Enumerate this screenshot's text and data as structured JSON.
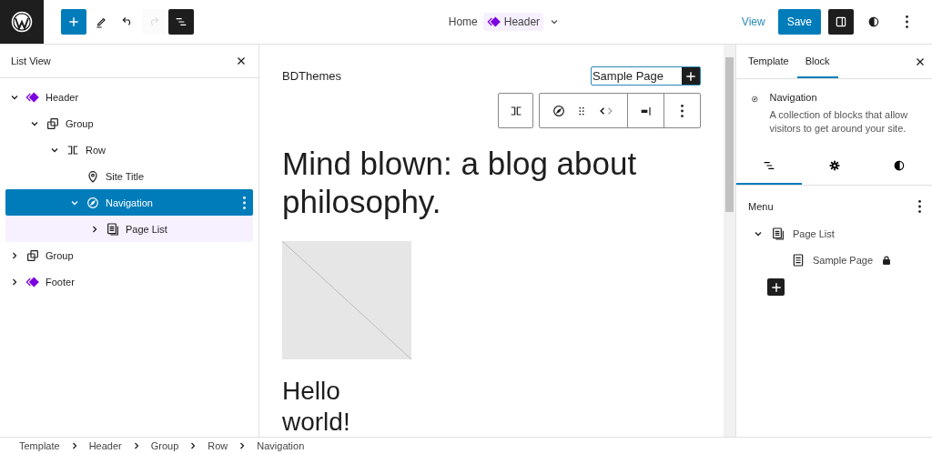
{
  "topbar": {
    "tools": [
      {
        "kind": "add",
        "active": true,
        "disabled": false
      },
      {
        "kind": "pencil",
        "active": false,
        "disabled": false
      },
      {
        "kind": "undo",
        "active": false,
        "disabled": false
      },
      {
        "kind": "redo",
        "active": false,
        "disabled": true
      },
      {
        "kind": "list",
        "active": true,
        "disabled": false
      }
    ],
    "breadcrumb": {
      "home": "Home",
      "current": "Header"
    },
    "view_link": "View",
    "save_button": "Save",
    "right_tools": [
      {
        "kind": "sidebar",
        "active": true
      },
      {
        "kind": "contrast",
        "active": false
      },
      {
        "kind": "more",
        "active": false
      }
    ]
  },
  "list_view": {
    "title": "List View",
    "items": [
      {
        "label": "Header",
        "kind": "template-part",
        "expanded": true,
        "selected": false,
        "children": [
          {
            "label": "Group",
            "kind": "group",
            "expanded": true,
            "selected": false,
            "children": [
              {
                "label": "Row",
                "kind": "row",
                "expanded": true,
                "selected": false,
                "children": [
                  {
                    "label": "Site Title",
                    "kind": "pin",
                    "selected": false
                  },
                  {
                    "label": "Navigation",
                    "kind": "compass",
                    "expanded": true,
                    "selected": true,
                    "children": [
                      {
                        "label": "Page List",
                        "kind": "pages",
                        "expanded": false,
                        "selected": false
                      }
                    ]
                  }
                ]
              }
            ]
          }
        ]
      },
      {
        "label": "Group",
        "kind": "group",
        "expanded": false,
        "selected": false
      },
      {
        "label": "Footer",
        "kind": "template-part",
        "expanded": false,
        "selected": false
      }
    ]
  },
  "canvas": {
    "site_title": "BDThemes",
    "nav_item": "Sample Page",
    "heading": "Mind blown: a blog about philosophy.",
    "post_title": "Hello world!"
  },
  "breadcrumbs": [
    "Template",
    "Header",
    "Group",
    "Row",
    "Navigation"
  ],
  "inspector": {
    "tabs": [
      {
        "label": "Template",
        "selected": false
      },
      {
        "label": "Block",
        "selected": true
      }
    ],
    "block": {
      "name": "Navigation",
      "description": "A collection of blocks that allow visitors to get around your site."
    },
    "icon_tabs": [
      {
        "kind": "list",
        "selected": true
      },
      {
        "kind": "gear",
        "selected": false
      },
      {
        "kind": "contrast",
        "selected": false
      }
    ],
    "menu_title": "Menu",
    "menu_items": [
      {
        "label": "Page List",
        "kind": "pages",
        "expanded": true,
        "children": [
          {
            "label": "Sample Page",
            "kind": "page",
            "locked": true
          }
        ]
      }
    ]
  }
}
